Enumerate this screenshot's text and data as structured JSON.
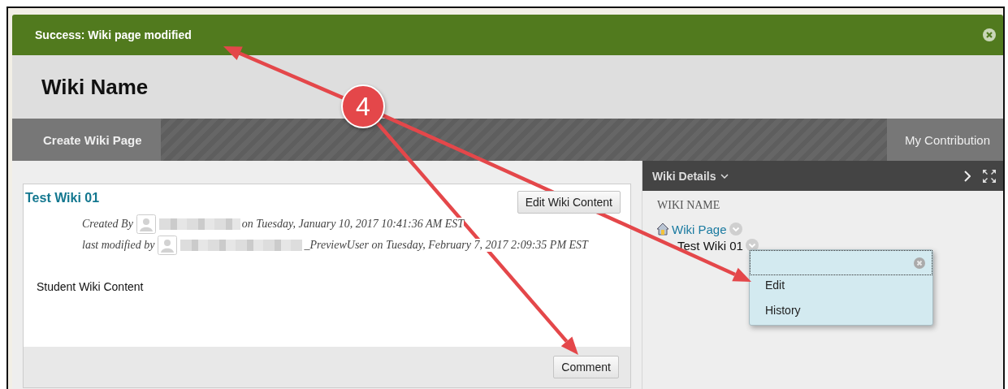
{
  "notification": {
    "message": "Success: Wiki page modified"
  },
  "page_title": "Wiki Name",
  "action_bar": {
    "left": "Create Wiki Page",
    "right": "My Contribution"
  },
  "wiki_page": {
    "title": "Test Wiki 01",
    "edit_button": "Edit Wiki Content",
    "meta": [
      {
        "label": "Created By",
        "text": "on Tuesday, January 10, 2017 10:41:36 AM EST"
      },
      {
        "label": "last modified by",
        "text": "_PreviewUser on Tuesday, February 7, 2017 2:09:35 PM EST"
      }
    ],
    "content": "Student Wiki Content",
    "comment_button": "Comment"
  },
  "details_panel": {
    "title": "Wiki Details",
    "section_heading": "WIKI NAME",
    "tree": [
      {
        "label": "Wiki Page",
        "children": [
          {
            "label": "Test Wiki 01"
          }
        ]
      }
    ]
  },
  "context_menu": {
    "items": [
      "Edit",
      "History"
    ]
  },
  "annotation": {
    "callout": "4"
  }
}
